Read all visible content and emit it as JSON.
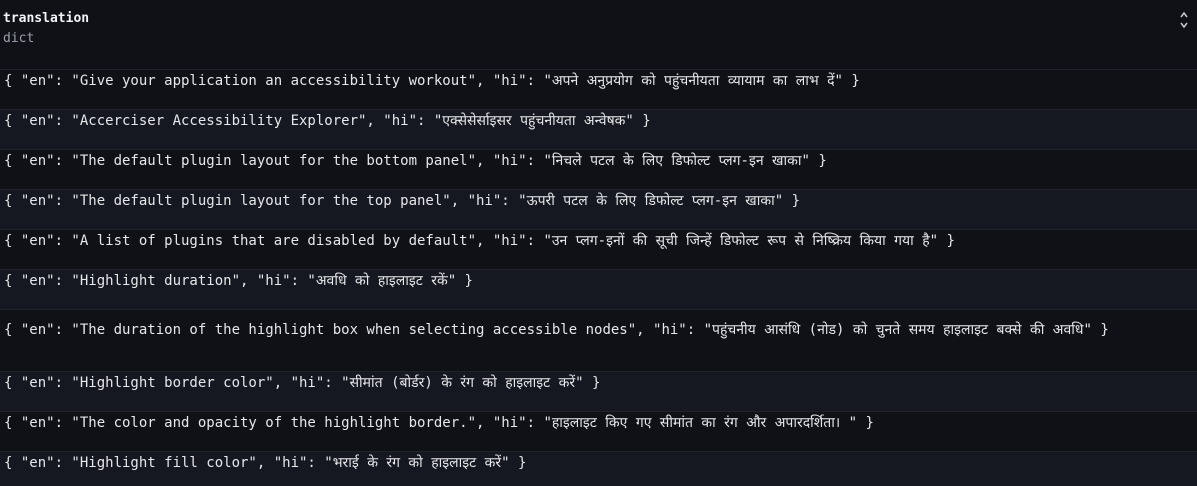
{
  "column": {
    "name": "translation",
    "type": "dict"
  },
  "rows": [
    "{ \"en\": \"Give your application an accessibility workout\", \"hi\": \"अपने अनुप्रयोग को पहुंचनीयता व्यायाम का लाभ दें\" }",
    "{ \"en\": \"Accerciser Accessibility Explorer\", \"hi\": \"एक्सेसेर्साइसर पहुंचनीयता अन्वेषक\" }",
    "{ \"en\": \"The default plugin layout for the bottom panel\", \"hi\": \"निचले पटल के लिए डिफोल्ट प्लग-इन खाका\" }",
    "{ \"en\": \"The default plugin layout for the top panel\", \"hi\": \"ऊपरी पटल के लिए डिफोल्ट प्लग-इन खाका\" }",
    "{ \"en\": \"A list of plugins that are disabled by default\", \"hi\": \"उन प्लग-इनों की सूची जिन्हें डिफोल्ट रूप से निष्क्रिय किया गया है\" }",
    "{ \"en\": \"Highlight duration\", \"hi\": \"अवधि को हाइलाइट रकें\" }",
    "{ \"en\": \"The duration of the highlight box when selecting accessible nodes\", \"hi\": \"पहुंचनीय आसंधि (नोड) को चुनते समय हाइलाइट बक्से की अवधि\" }",
    "{ \"en\": \"Highlight border color\", \"hi\": \"सीमांत (बोर्डर) के रंग को हाइलाइट करें\" }",
    "{ \"en\": \"The color and opacity of the highlight border.\", \"hi\": \"हाइलाइट किए गए सीमांत का रंग और अपारदर्शिता। \" }",
    "{ \"en\": \"Highlight fill color\", \"hi\": \"भराई के रंग को हाइलाइट करें\" }"
  ]
}
